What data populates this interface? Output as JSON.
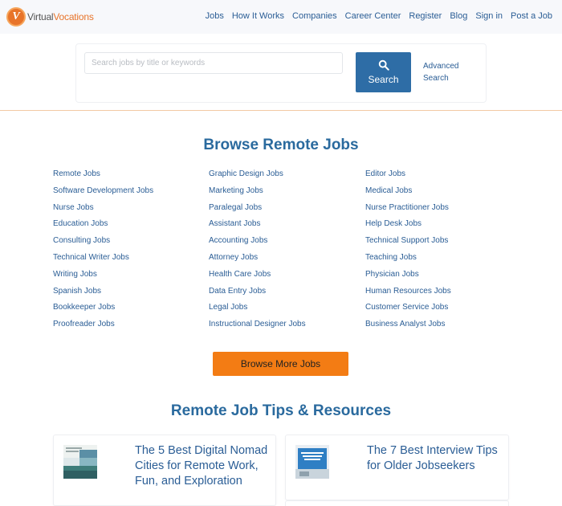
{
  "header": {
    "logo_text_a": "Virtual",
    "logo_text_b": "Vocations",
    "logo_letter": "V",
    "nav": [
      "Jobs",
      "How It Works",
      "Companies",
      "Career Center",
      "Register",
      "Blog",
      "Sign in",
      "Post a Job"
    ]
  },
  "search": {
    "placeholder": "Search jobs by title or keywords",
    "value": "",
    "button_label": "Search",
    "advanced_label": "Advanced Search",
    "icon": "search-icon"
  },
  "browse": {
    "title": "Browse Remote Jobs",
    "col1": [
      "Remote Jobs",
      "Software Development Jobs",
      "Nurse Jobs",
      "Education Jobs",
      "Consulting Jobs",
      "Technical Writer Jobs",
      "Writing Jobs",
      "Spanish Jobs",
      "Bookkeeper Jobs",
      "Proofreader Jobs"
    ],
    "col2": [
      "Graphic Design Jobs",
      "Marketing Jobs",
      "Paralegal Jobs",
      "Assistant Jobs",
      "Accounting Jobs",
      "Attorney Jobs",
      "Health Care Jobs",
      "Data Entry Jobs",
      "Legal Jobs",
      "Instructional Designer Jobs"
    ],
    "col3": [
      "Editor Jobs",
      "Medical Jobs",
      "Nurse Practitioner Jobs",
      "Help Desk Jobs",
      "Technical Support Jobs",
      "Teaching Jobs",
      "Physician Jobs",
      "Human Resources Jobs",
      "Customer Service Jobs",
      "Business Analyst Jobs"
    ],
    "more_button": "Browse More Jobs"
  },
  "tips": {
    "title": "Remote Job Tips & Resources",
    "cards": [
      {
        "title": "The 5 Best Digital Nomad Cities for Remote Work, Fun, and Exploration"
      },
      {
        "title": "The 7 Best Interview Tips for Older Jobseekers"
      }
    ]
  },
  "colors": {
    "accent_blue": "#2e6da6",
    "link_blue": "#2a5d95",
    "brand_orange": "#f37c14"
  }
}
